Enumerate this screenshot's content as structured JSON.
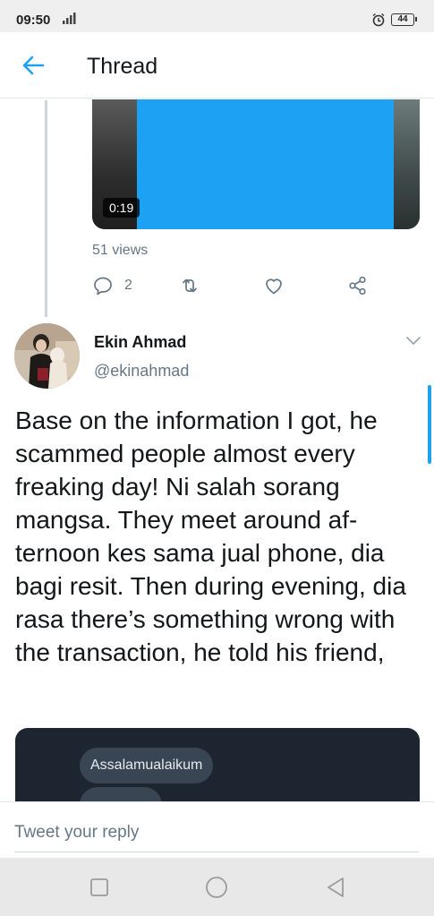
{
  "status_bar": {
    "time": "09:50",
    "battery": "44"
  },
  "header": {
    "title": "Thread",
    "back_icon": "arrow-left-icon"
  },
  "video": {
    "duration": "0:19",
    "views": "51 views"
  },
  "actions": {
    "reply_count": "2"
  },
  "tweet": {
    "author_name": "Ekin Ahmad",
    "author_handle": "@ekinahmad",
    "text": "Base on the information I got, he scammed people almost every freaking day! Ni salah sorang mangsa. They meet around af-ternoon kes sama jual phone, dia bagi resit. Then during evening, dia rasa there’s something wrong with the transaction, he told his friend,",
    "media_message": "Assalamualaikum"
  },
  "reply": {
    "placeholder": "Tweet your reply"
  },
  "colors": {
    "accent": "#1da1f2",
    "secondary_text": "#657786"
  }
}
